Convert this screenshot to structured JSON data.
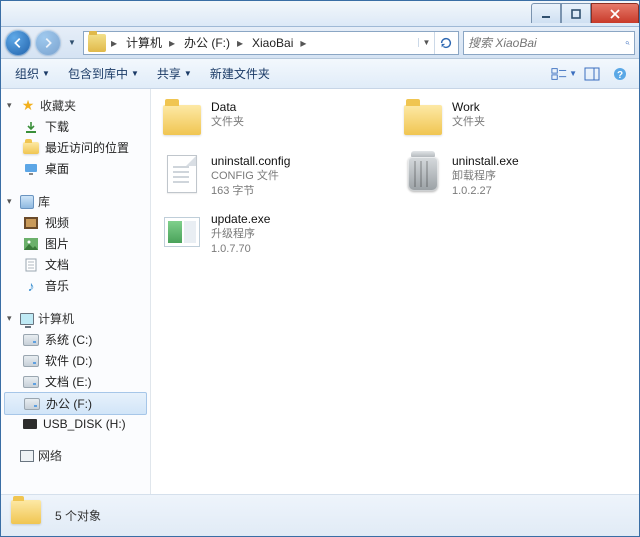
{
  "breadcrumb": {
    "seg1": "计算机",
    "seg2": "办公 (F:)",
    "seg3": "XiaoBai"
  },
  "search": {
    "placeholder": "搜索 XiaoBai"
  },
  "toolbar": {
    "organize": "组织",
    "include": "包含到库中",
    "share": "共享",
    "newfolder": "新建文件夹"
  },
  "sidebar": {
    "fav": {
      "label": "收藏夹",
      "items": [
        "下载",
        "最近访问的位置",
        "桌面"
      ]
    },
    "lib": {
      "label": "库",
      "items": [
        "视频",
        "图片",
        "文档",
        "音乐"
      ]
    },
    "comp": {
      "label": "计算机",
      "items": [
        "系统 (C:)",
        "软件 (D:)",
        "文档 (E:)",
        "办公 (F:)",
        "USB_DISK (H:)"
      ]
    },
    "net": {
      "label": "网络"
    }
  },
  "files": {
    "f0": {
      "name": "Data",
      "meta1": "文件夹"
    },
    "f1": {
      "name": "Work",
      "meta1": "文件夹"
    },
    "f2": {
      "name": "uninstall.config",
      "meta1": "CONFIG 文件",
      "meta2": "163 字节"
    },
    "f3": {
      "name": "uninstall.exe",
      "meta1": "卸载程序",
      "meta2": "1.0.2.27"
    },
    "f4": {
      "name": "update.exe",
      "meta1": "升级程序",
      "meta2": "1.0.7.70"
    }
  },
  "status": {
    "text": "5 个对象"
  }
}
